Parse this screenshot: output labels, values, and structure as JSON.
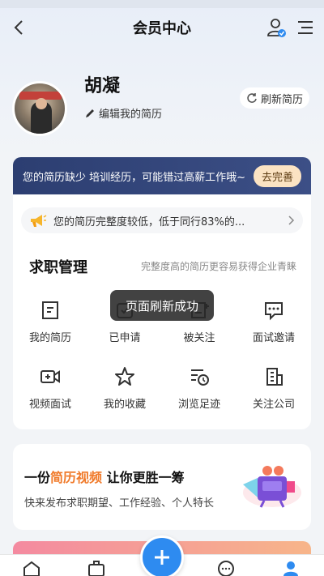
{
  "header": {
    "title": "会员中心"
  },
  "profile": {
    "name": "胡凝",
    "edit_label": "编辑我的简历",
    "refresh_label": "刷新简历"
  },
  "banner": {
    "text": "您的简历缺少 培训经历，可能错过高薪工作哦~",
    "button_label": "去完善"
  },
  "notice": {
    "text": "您的简历完整度较低，低于同行83%的..."
  },
  "job_management": {
    "title": "求职管理",
    "subtitle": "完整度高的简历更容易获得企业青睐",
    "items": [
      {
        "label": "我的简历",
        "icon": "resume-icon"
      },
      {
        "label": "已申请",
        "icon": "applied-icon"
      },
      {
        "label": "被关注",
        "icon": "followed-icon"
      },
      {
        "label": "面试邀请",
        "icon": "interview-invite-icon"
      },
      {
        "label": "视频面试",
        "icon": "video-interview-icon"
      },
      {
        "label": "我的收藏",
        "icon": "star-icon"
      },
      {
        "label": "浏览足迹",
        "icon": "history-icon"
      },
      {
        "label": "关注公司",
        "icon": "building-icon"
      }
    ]
  },
  "toast": {
    "text": "页面刷新成功"
  },
  "promo": {
    "title_prefix": "一份",
    "title_highlight": "简历视频",
    "title_suffix": " 让你更胜一筹",
    "subtitle": "快来发布求职期望、工作经验、个人特长"
  },
  "colors": {
    "accent": "#2e8bf0",
    "highlight": "#f07a2a",
    "banner": "#2c3e71"
  }
}
